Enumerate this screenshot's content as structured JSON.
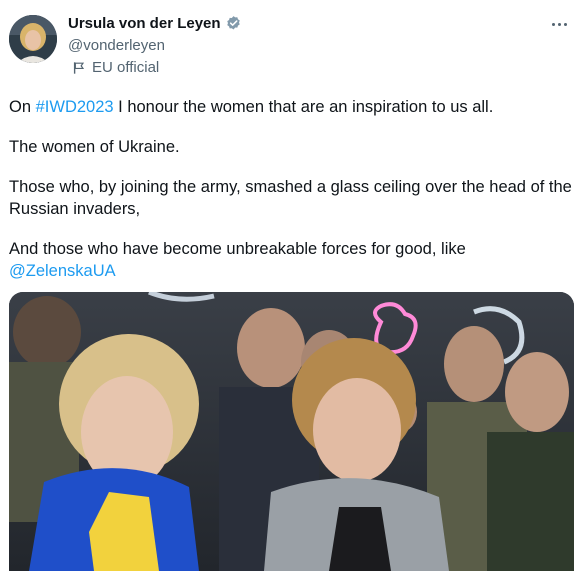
{
  "author": {
    "name": "Ursula von der Leyen",
    "handle": "@vonderleyen",
    "affiliation": "EU official",
    "verified_icon": "verified-badge-gray",
    "avatar_icon": "profile-photo"
  },
  "menu": {
    "more_icon": "more-horizontal-icon"
  },
  "tweet": {
    "line1_prefix": "On ",
    "hashtag": "#IWD2023",
    "line1_suffix": " I honour the women that are an inspiration to us all.",
    "para2": "The women of Ukraine.",
    "para3": "Those who, by joining the army, smashed a glass ceiling over the head of the Russian invaders,",
    "para4_prefix": "And those who have become unbreakable forces for good, like",
    "mention": "@ZelenskaUA"
  },
  "media": {
    "description_icon": "photo-attachment"
  },
  "colors": {
    "link": "#1d9bf0",
    "text": "#0f1419",
    "secondary": "#536471"
  }
}
